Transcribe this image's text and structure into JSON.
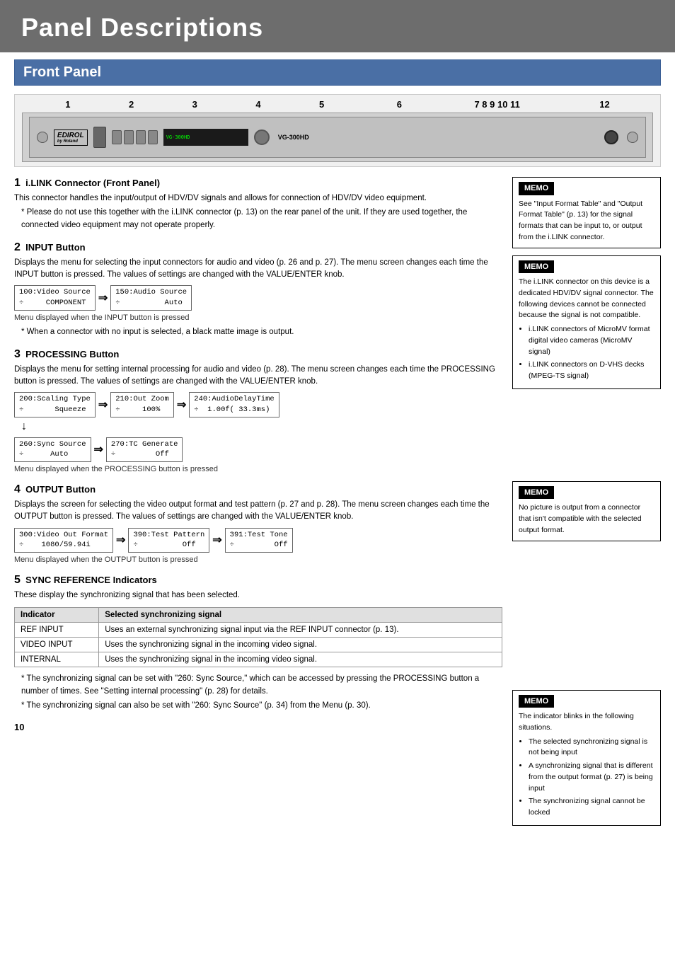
{
  "header": {
    "title": "Panel Descriptions"
  },
  "section": {
    "title": "Front Panel"
  },
  "device": {
    "numbers_top": "1   2  3  4  5            6                  7 8 9 10 11                              12",
    "logo": "EDIROL",
    "model": "VG-300HD"
  },
  "items": [
    {
      "number": "1",
      "title": "i.LINK Connector (Front Panel)",
      "paragraphs": [
        "This connector handles the input/output of HDV/DV signals and allows for connection of HDV/DV video equipment.",
        "* Please do not use this together with the i.LINK connector (p. 13) on the rear panel of the unit. If they are used together, the connected video equipment may not operate properly."
      ],
      "has_menu": false
    },
    {
      "number": "2",
      "title": "INPUT Button",
      "paragraphs": [
        "Displays the menu for selecting the input connectors for audio and video (p. 26 and p. 27). The menu screen changes each time the INPUT button is pressed. The values of settings are changed with the VALUE/ENTER knob."
      ],
      "menu_rows": [
        {
          "boxes": [
            "100:Video Source\n÷     COMPONENT",
            "150:Audio Source\n÷          Auto"
          ],
          "arrows": [
            true
          ]
        }
      ],
      "menu_caption": "Menu displayed when the INPUT button is pressed",
      "note": "When a connector with no input is selected, a black matte image is output."
    },
    {
      "number": "3",
      "title": "PROCESSING Button",
      "paragraphs": [
        "Displays the menu for setting internal processing for audio and video (p. 28). The menu screen changes each time the PROCESSING button is pressed. The values of settings are changed with the VALUE/ENTER knob."
      ],
      "menu_rows": [
        {
          "boxes": [
            "200:Scaling Type\n÷       Squeeze",
            "210:Out Zoom\n÷     100%",
            "240:AudioDelayTime\n÷  1.00f( 33.3ms)"
          ],
          "arrows": [
            true,
            true
          ]
        },
        {
          "boxes": [
            "260:Sync Source\n÷      Auto",
            "270:TC Generate\n÷         Off"
          ],
          "arrows": [
            true
          ]
        }
      ],
      "menu_caption": "Menu displayed when the PROCESSING button is pressed"
    },
    {
      "number": "4",
      "title": "OUTPUT Button",
      "paragraphs": [
        "Displays the screen for selecting the video output format and test pattern (p. 27 and p. 28). The menu screen changes each time the OUTPUT button is pressed. The values of settings are changed with the VALUE/ENTER knob."
      ],
      "menu_rows": [
        {
          "boxes": [
            "300:Video Out Format\n÷    1080/59.94i",
            "390:Test Pattern\n÷          Off",
            "391:Test Tone\n÷         Off"
          ],
          "arrows": [
            true,
            true
          ]
        }
      ],
      "menu_caption": "Menu displayed when the OUTPUT button is pressed"
    },
    {
      "number": "5",
      "title": "SYNC REFERENCE Indicators",
      "paragraphs": [
        "These display the synchronizing signal that has been selected."
      ],
      "table": {
        "headers": [
          "Indicator",
          "Selected synchronizing signal"
        ],
        "rows": [
          [
            "REF INPUT",
            "Uses an external synchronizing signal input via the REF INPUT connector (p. 13)."
          ],
          [
            "VIDEO INPUT",
            "Uses the synchronizing signal in the incoming video signal."
          ],
          [
            "INTERNAL",
            "Uses the synchronizing signal in the incoming video signal."
          ]
        ]
      },
      "notes": [
        "The synchronizing signal can be set with \"260: Sync Source,\" which can be accessed by pressing the PROCESSING button a number of times. See \"Setting internal processing\" (p. 28) for details.",
        "The synchronizing signal can also be set with \"260: Sync Source\" (p. 34) from the Menu (p. 30)."
      ]
    }
  ],
  "memos": [
    {
      "title": "MEMO",
      "text": "See \"Input Format Table\" and \"Output Format Table\" (p. 13) for the signal formats that can be input to, or output from the i.LINK connector."
    },
    {
      "title": "MEMO",
      "text": "The i.LINK connector on this device is a dedicated HDV/DV signal connector. The following devices cannot be connected because the signal is not compatible.",
      "bullets": [
        "i.LINK connectors of MicroMV format digital video cameras (MicroMV signal)",
        "i.LINK connectors on D-VHS decks (MPEG-TS signal)"
      ]
    },
    {
      "title": "MEMO",
      "text": "No picture is output from a connector that isn't compatible with the selected output format."
    },
    {
      "title": "MEMO",
      "text": "The indicator blinks in the following situations.",
      "bullets": [
        "The selected synchronizing signal is not being input",
        "A synchronizing signal that is different from the output format (p. 27) is being input",
        "The synchronizing signal cannot be locked"
      ]
    }
  ],
  "page_number": "10"
}
